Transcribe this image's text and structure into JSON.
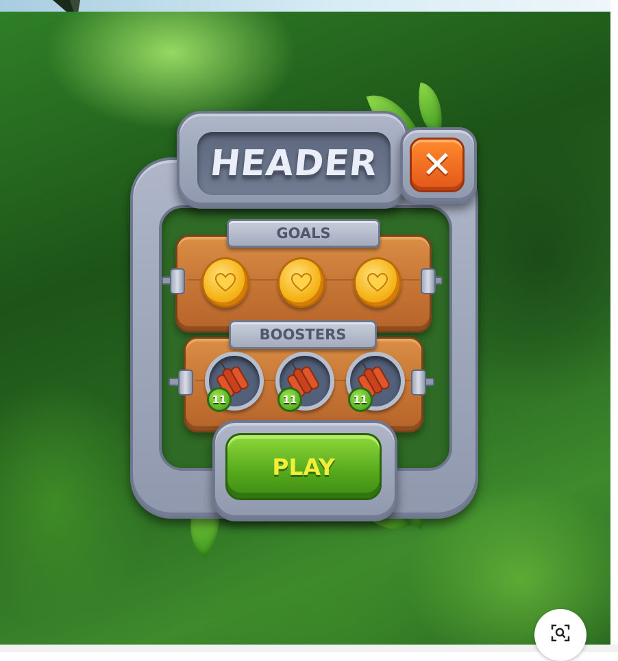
{
  "dialog": {
    "header_title": "HEADER",
    "close_glyph": "✕",
    "goals": {
      "label": "GOALS",
      "items": [
        {
          "icon": "heart-coin-icon"
        },
        {
          "icon": "heart-coin-icon"
        },
        {
          "icon": "heart-coin-icon"
        }
      ]
    },
    "boosters": {
      "label": "BOOSTERS",
      "items": [
        {
          "icon": "dynamite-icon",
          "count": "11"
        },
        {
          "icon": "dynamite-icon",
          "count": "11"
        },
        {
          "icon": "dynamite-icon",
          "count": "11"
        }
      ]
    },
    "play_label": "PLAY"
  },
  "overlay": {
    "visual_search_icon": "lens-search-icon"
  },
  "colors": {
    "close_button": "#e9661f",
    "play_button": "#5bb31f",
    "play_text": "#f3ee3a",
    "stone": "#9ea6b9",
    "wood": "#c97a38",
    "coin": "#f6b51a",
    "badge": "#4aa01c"
  }
}
